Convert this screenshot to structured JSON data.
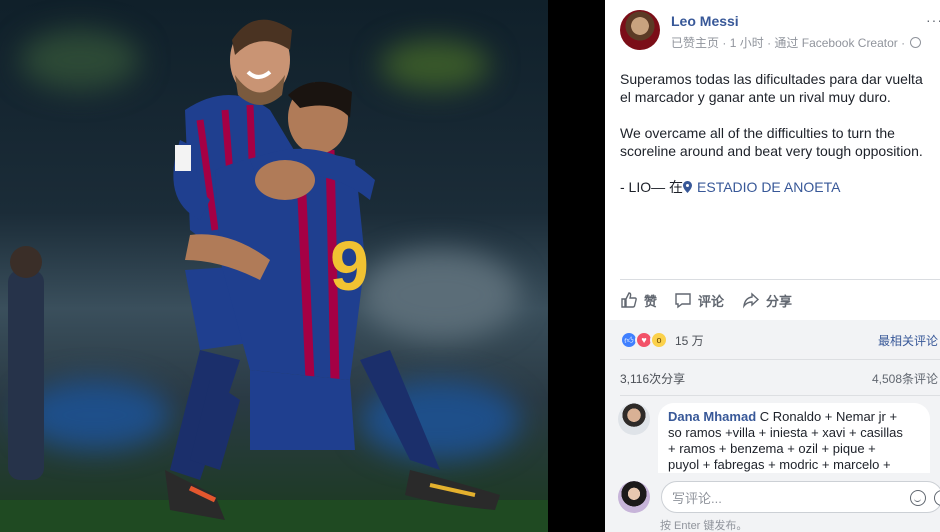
{
  "post": {
    "author": "Leo Messi",
    "meta": {
      "page_type": "已赞主页",
      "dot1": "·",
      "time": "1 小时",
      "dot2": "·",
      "via": "通过 Facebook Creator",
      "dot3": "·"
    },
    "more_label": "···",
    "text_es": "Superamos todas las dificultades para dar vuelta el marcador y ganar ante un rival muy duro.",
    "text_es_line1": "Superamos todas las dificultades para dar vuelta",
    "text_es_line2": "el marcador y ganar ante un rival muy duro.",
    "text_en_line1": "We overcame all of the difficulties to turn the",
    "text_en_line2": "scoreline around and beat very tough opposition.",
    "signature": "- LIO— 在",
    "location": "ESTADIO DE ANOETA"
  },
  "actions": {
    "like": "赞",
    "comment": "评论",
    "share": "分享"
  },
  "stats": {
    "reaction_count": "15 万",
    "most_relevant": "最相关评论",
    "shares": "3,116次分享",
    "comments": "4,508条评论"
  },
  "comment": {
    "author": "Dana Mhamad",
    "line1": "C Ronaldo + Nemar jr +",
    "line2": "so ramos +villa + iniesta + xavi + casillas",
    "line3": "+ ramos + benzema + ozil + pique +",
    "line4": "puyol + fabregas + modric + marcelo +"
  },
  "composer": {
    "placeholder": "写评论...",
    "hint": "按 Enter 键发布。"
  },
  "icons": [
    "like-icon",
    "comment-icon",
    "share-icon",
    "location-pin-icon",
    "globe-icon",
    "emoji-icon",
    "camera-icon",
    "more-icon"
  ],
  "colors": {
    "link_blue": "#385898",
    "like_blue": "#4080ff",
    "love_red": "#f25268",
    "wow_yellow": "#fbd14b",
    "panel_gray": "#f2f3f5",
    "barca_blue": "#1f3f8f",
    "barca_red": "#a50044"
  }
}
